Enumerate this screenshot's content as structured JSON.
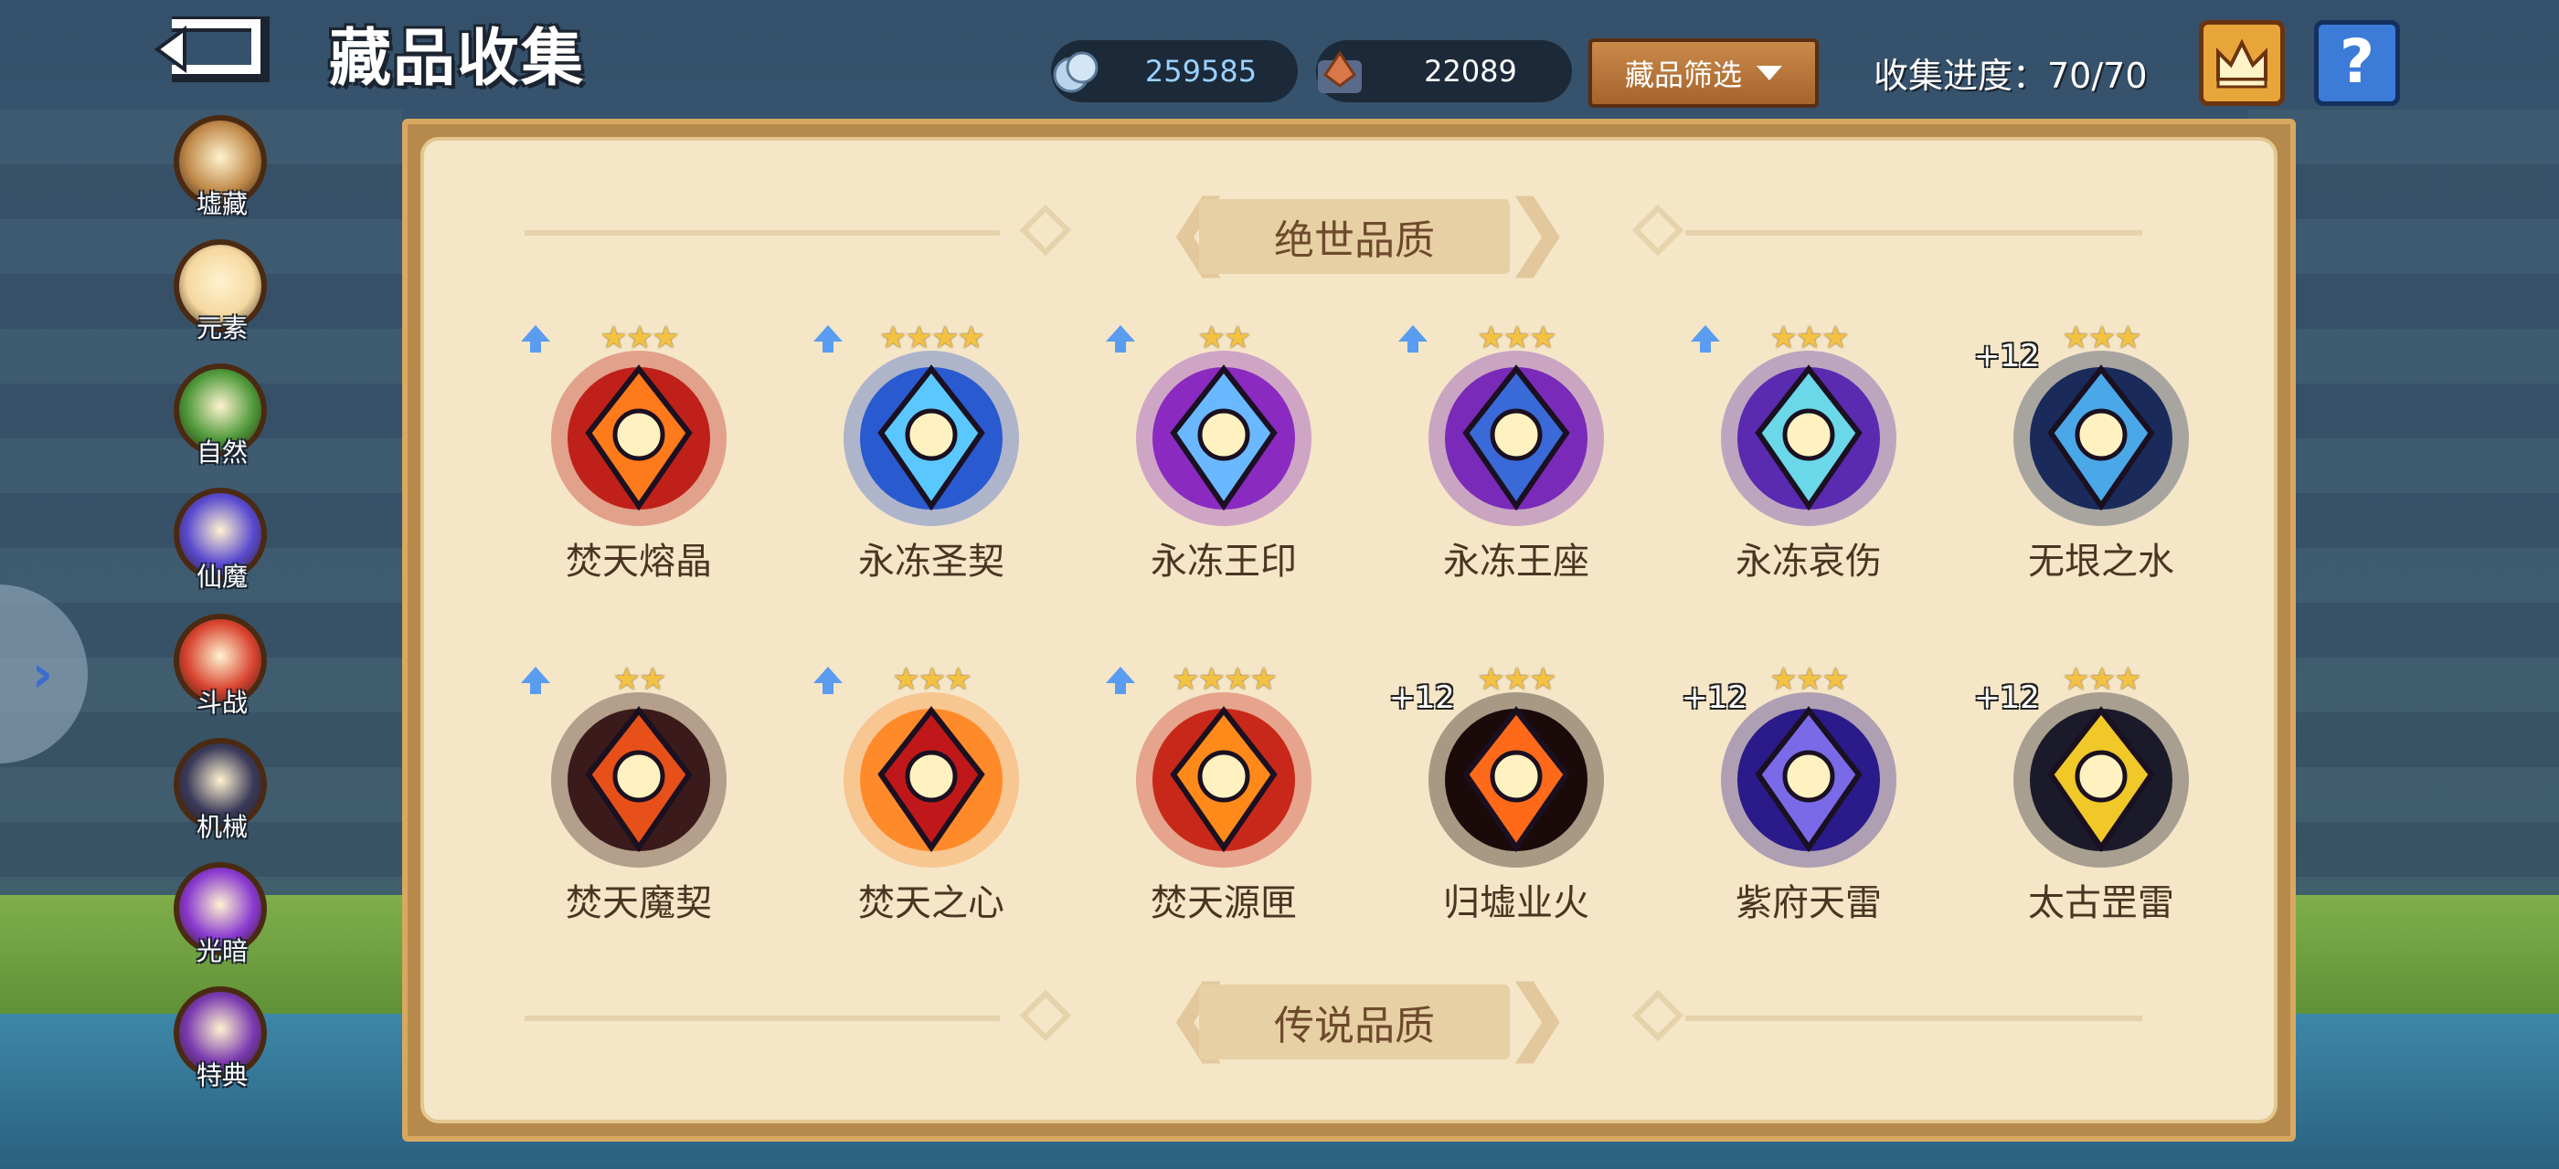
{
  "header": {
    "title": "藏品收集",
    "currency_1": {
      "value": "259585",
      "icon": "shell-coin-icon"
    },
    "currency_2": {
      "value": "22089",
      "icon": "ore-gem-icon"
    },
    "filter_label": "藏品筛选",
    "progress": "收集进度：70/70",
    "help_symbol": "?"
  },
  "categories": [
    {
      "label": "墟藏",
      "color": "#c08a4a",
      "active": false
    },
    {
      "label": "元素",
      "color": "#f5d8a0",
      "active": true
    },
    {
      "label": "自然",
      "color": "#4f9a3a",
      "active": false
    },
    {
      "label": "仙魔",
      "color": "#5a4ad0",
      "active": false
    },
    {
      "label": "斗战",
      "color": "#d94430",
      "active": false
    },
    {
      "label": "机械",
      "color": "#3a3a5a",
      "active": false
    },
    {
      "label": "光暗",
      "color": "#8a3ad0",
      "active": false
    },
    {
      "label": "特典",
      "color": "#7a3ab0",
      "active": false
    }
  ],
  "sections": {
    "top": "绝世品质",
    "bottom": "传说品质"
  },
  "items": [
    {
      "name": "焚天熔晶",
      "stars": "★★★",
      "upgrade": true,
      "plus": "",
      "color1": "#ff7a1a",
      "color2": "#c0201a"
    },
    {
      "name": "永冻圣契",
      "stars": "★★★★",
      "upgrade": true,
      "plus": "",
      "color1": "#5ac8ff",
      "color2": "#2a5ad0"
    },
    {
      "name": "永冻王印",
      "stars": "★★",
      "upgrade": true,
      "plus": "",
      "color1": "#6ab8ff",
      "color2": "#8a2ac0"
    },
    {
      "name": "永冻王座",
      "stars": "★★★",
      "upgrade": true,
      "plus": "",
      "color1": "#3a6ad8",
      "color2": "#7a2ab8"
    },
    {
      "name": "永冻哀伤",
      "stars": "★★★",
      "upgrade": true,
      "plus": "",
      "color1": "#6ad8e8",
      "color2": "#5a2ab0"
    },
    {
      "name": "无垠之水",
      "stars": "★★★",
      "upgrade": false,
      "plus": "+12",
      "color1": "#4aa8e8",
      "color2": "#1a2a5a"
    },
    {
      "name": "焚天魔契",
      "stars": "★★",
      "upgrade": true,
      "plus": "",
      "color1": "#e8501a",
      "color2": "#3a1a1a"
    },
    {
      "name": "焚天之心",
      "stars": "★★★",
      "upgrade": true,
      "plus": "",
      "color1": "#c0181a",
      "color2": "#ff8a2a"
    },
    {
      "name": "焚天源匣",
      "stars": "★★★★",
      "upgrade": true,
      "plus": "",
      "color1": "#ff8a1a",
      "color2": "#c8281a"
    },
    {
      "name": "归墟业火",
      "stars": "★★★",
      "upgrade": false,
      "plus": "+12",
      "color1": "#ff6a1a",
      "color2": "#1a0a0a"
    },
    {
      "name": "紫府天雷",
      "stars": "★★★",
      "upgrade": false,
      "plus": "+12",
      "color1": "#7a6ae8",
      "color2": "#2a1a8a"
    },
    {
      "name": "太古罡雷",
      "stars": "★★★",
      "upgrade": false,
      "plus": "+12",
      "color1": "#f0c828",
      "color2": "#1a1a2a"
    }
  ],
  "partial_row": [
    {
      "stars": "★★★",
      "upgrade": true
    },
    {
      "stars": "★★★",
      "upgrade": false
    },
    {
      "stars": "★",
      "upgrade": true
    },
    {
      "stars": "★",
      "upgrade": true
    },
    {
      "stars": "★★",
      "upgrade": false
    },
    {
      "stars": "★★★",
      "upgrade": true
    }
  ],
  "colors": {
    "panel_bg": "#f5e6c8",
    "panel_border": "#d8a860",
    "accent_orange": "#c98a4b",
    "help_blue": "#3d7bd8",
    "star_gold": "#f3c242"
  }
}
